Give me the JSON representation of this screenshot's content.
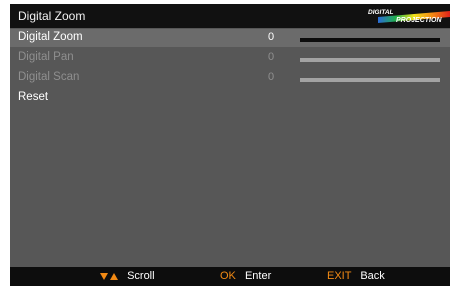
{
  "window": {
    "title": "Digital Zoom",
    "logo_text_top": "DIGITAL",
    "logo_text_bottom": "PROJECTION"
  },
  "menu": {
    "items": [
      {
        "label": "Digital Zoom",
        "value": "0",
        "state": "enabled",
        "selected": true
      },
      {
        "label": "Digital Pan",
        "value": "0",
        "state": "disabled",
        "selected": false
      },
      {
        "label": "Digital Scan",
        "value": "0",
        "state": "disabled",
        "selected": false
      },
      {
        "label": "Reset",
        "value": "",
        "state": "enabled",
        "selected": false
      }
    ]
  },
  "footer": {
    "scroll_label": "Scroll",
    "ok_key": "OK",
    "ok_label": "Enter",
    "exit_key": "EXIT",
    "exit_label": "Back"
  },
  "colors": {
    "accent": "#f28a14",
    "background": "#575757",
    "title_bar": "#111111",
    "selected_row": "#6b6b6b",
    "disabled_text": "#8f8f8f"
  },
  "icons": {
    "scroll": "down-up-arrows-icon"
  }
}
